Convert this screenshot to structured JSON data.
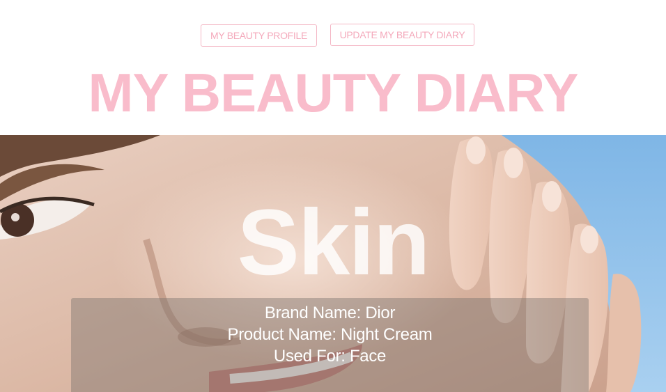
{
  "nav": {
    "profile_label": "MY BEAUTY PROFILE",
    "update_label": "UPDATE MY BEAUTY DIARY"
  },
  "site_title": "MY BEAUTY DIARY",
  "hero": {
    "title": "Skin",
    "photo": "woman-face-hand-on-cheek",
    "entry": {
      "brand": "Brand Name: Dior",
      "product": "Product Name: Night Cream",
      "used_for": "Used For: Face"
    }
  },
  "colors": {
    "accent_pink": "#f9bccb",
    "button_border": "#f4b7c5",
    "sky_blue": "#8ec1ea"
  }
}
